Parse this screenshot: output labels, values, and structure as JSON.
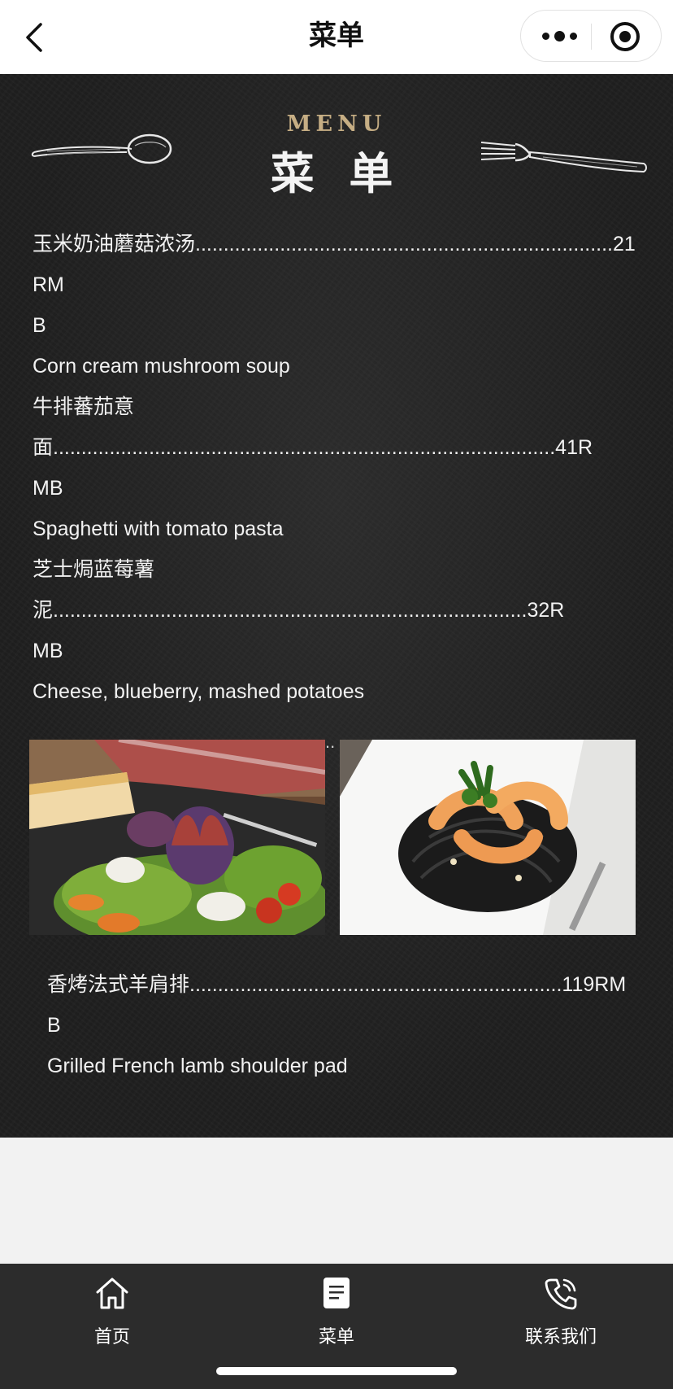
{
  "header": {
    "title": "菜单",
    "back_icon": "chevron-left-icon",
    "more_icon": "more-dots-icon",
    "close_icon": "target-icon"
  },
  "menu": {
    "heading_en": "MENU",
    "heading_cn": "菜 单",
    "left_decor_icon": "spoon-icon",
    "right_decor_icon": "fork-icon",
    "items": [
      {
        "name_line": "玉米奶油蘑菇浓汤..........................................................................21RM",
        "wrap": "B",
        "english": "Corn cream mushroom soup"
      },
      {
        "name_line": "牛排蕃茄意面.........................................................................................41R",
        "wrap": "MB",
        "english": "Spaghetti with tomato pasta"
      },
      {
        "name_line": "芝士焗蓝莓薯泥....................................................................................32R",
        "wrap": "MB",
        "english": "Cheese, blueberry, mashed potatoes"
      },
      {
        "name_line": "香烤法式羊肩排..................................................................119RM",
        "wrap": "B",
        "english": "Grilled French lamb shoulder pad"
      }
    ],
    "photos": [
      {
        "name": "fig-salad-photo",
        "description_icon": "salad-photo"
      },
      {
        "name": "shrimp-squid-ink-pasta-photo",
        "description_icon": "pasta-photo"
      }
    ],
    "hidden_dots": ".."
  },
  "tabbar": {
    "tabs": [
      {
        "label": "首页",
        "icon": "home-icon"
      },
      {
        "label": "菜单",
        "icon": "document-icon"
      },
      {
        "label": "联系我们",
        "icon": "phone-icon"
      }
    ]
  },
  "colors": {
    "board_bg": "#1f1f1f",
    "menu_en_gold": "#c6ae84",
    "tabbar_bg": "#2c2c2c",
    "page_bg": "#f2f2f2"
  }
}
